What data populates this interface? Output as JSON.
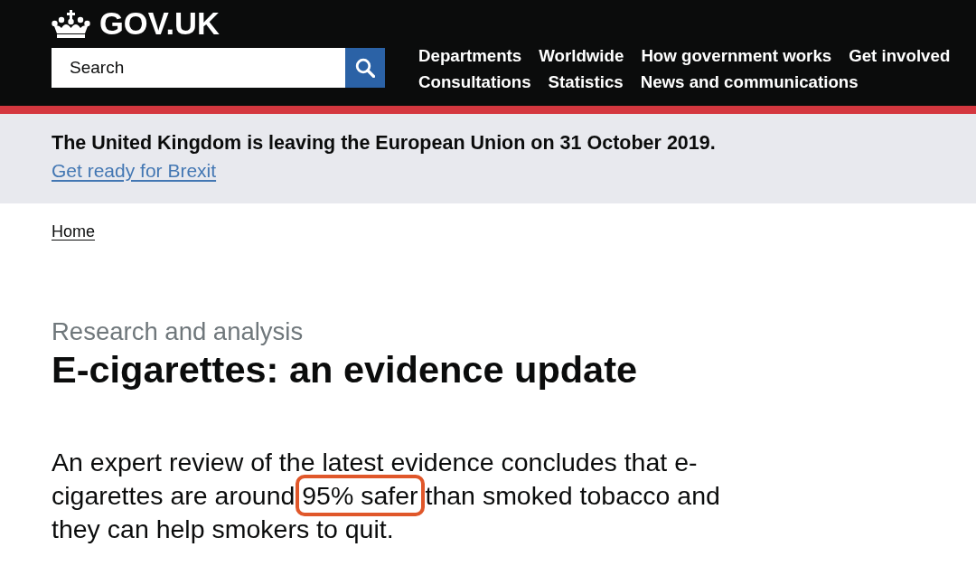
{
  "header": {
    "logo": {
      "text": "GOV.UK"
    },
    "search": {
      "placeholder": "Search"
    },
    "navigation": {
      "rows": [
        [
          "Departments",
          "Worldwide",
          "How government works",
          "Get involved"
        ],
        [
          "Consultations",
          "Statistics",
          "News and communications"
        ]
      ]
    }
  },
  "banner": {
    "message": "The United Kingdom is leaving the European Union on 31 October 2019.",
    "link": "Get ready for Brexit"
  },
  "breadcrumbs": [
    {
      "label": "Home"
    }
  ],
  "document": {
    "type_label": "Research and analysis",
    "title": "E-cigarettes: an evidence update",
    "summary": [
      {
        "text": "An expert review of the latest evidence concludes that e-cigarettes are around ",
        "highlighted": false
      },
      {
        "text": "95% safer",
        "highlighted": true
      },
      {
        "text": " than smoked tobacco and they can help smokers to quit.",
        "highlighted": false
      }
    ]
  }
}
